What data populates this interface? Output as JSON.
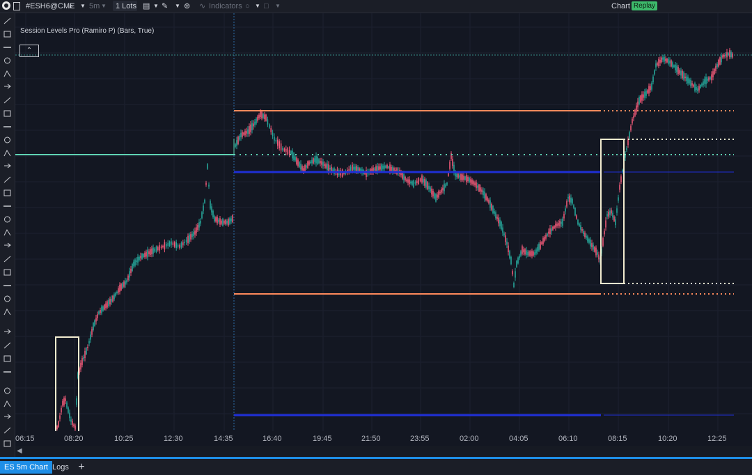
{
  "toolbar": {
    "symbol": "#ESH6@CME",
    "interval": "5m",
    "lots_label": "1 Lots",
    "indicators_label": "Indicators",
    "chart_label": "Chart",
    "replay_label": "Replay",
    "icons": [
      "logo-icon",
      "search-icon",
      "chevron-down-icon",
      "notes-icon",
      "pencil-icon",
      "zoom-icon",
      "indicators-icon",
      "circle-icon",
      "window-icon"
    ]
  },
  "indicator": {
    "title": "Session Levels Pro (Ramiro P) (Bars, True)",
    "collapse_icon": "chevron-up-icon"
  },
  "time_axis": [
    "06:15",
    "08:20",
    "10:25",
    "12:30",
    "14:35",
    "16:40",
    "19:45",
    "21:50",
    "23:55",
    "02:00",
    "04:05",
    "06:10",
    "08:15",
    "10:20",
    "12:25"
  ],
  "colors": {
    "background": "#131722",
    "up_candle": "#26a69a",
    "down_candle": "#ef5a78",
    "orange_level": "#ff8a5c",
    "blue_level": "#1f2fd6",
    "teal_level": "#5fd3b3",
    "box": "#f2ecd0",
    "tab_accent": "#1e8ee6",
    "replay_badge": "#3dbb6b"
  },
  "tabs": [
    {
      "label": "ES 5m Chart",
      "active": true
    },
    {
      "label": "Logs",
      "active": false
    }
  ],
  "sidebar_tools": [
    "line-icon",
    "ray-icon",
    "vertical-line-icon",
    "horizontal-line-icon",
    "arrow-icon",
    "crosshair-icon",
    "fib-icon",
    "pitchfork-icon",
    "pencil-icon",
    "measure-icon",
    "target-icon",
    "ruler-icon",
    "parallel-channel-icon",
    "triangle-icon",
    "rectangle-icon",
    "circle-icon",
    "gann-icon",
    "fan-icon",
    "pattern-icon",
    "elliott-icon",
    "path-icon",
    "grid-icon",
    "dots-icon",
    "text-icon",
    "tag-icon",
    "callout-icon",
    "note-icon",
    "dot-icon",
    "diamond-icon",
    "square-icon",
    "arrow-up-icon",
    "arrow-down-icon"
  ]
}
